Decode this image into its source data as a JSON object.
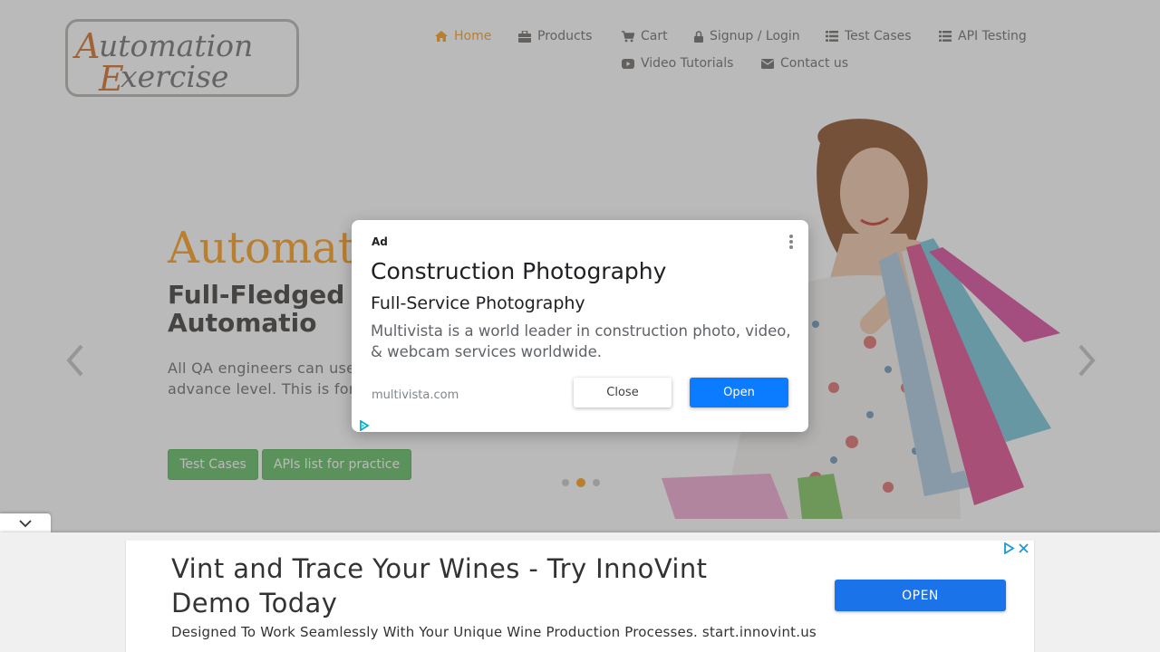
{
  "colors": {
    "accent": "#fe980f",
    "nav_text": "#696763",
    "button_green": "#5cb85c",
    "ad_open_blue": "#0b7cff",
    "bottom_ad_blue": "#1a73e8"
  },
  "logo": {
    "line1": "Automation",
    "line2": "Exercise"
  },
  "nav": [
    {
      "label": "Home",
      "icon": "home-icon"
    },
    {
      "label": "Products",
      "icon": "briefcase-icon"
    },
    {
      "label": "Cart",
      "icon": "cart-icon"
    },
    {
      "label": "Signup / Login",
      "icon": "lock-icon"
    },
    {
      "label": "Test Cases",
      "icon": "list-icon"
    },
    {
      "label": "API Testing",
      "icon": "list-icon"
    },
    {
      "label": "Video Tutorials",
      "icon": "youtube-play-icon"
    },
    {
      "label": "Contact us",
      "icon": "envelope-icon"
    }
  ],
  "slider": {
    "title": "Automat",
    "subtitle": "Full-Fledged for Automatio",
    "description": "All QA engineers can use practice and API testing e advance level. This is for their automation skills.",
    "buttons": [
      "Test Cases",
      "APIs list for practice"
    ],
    "active_slide": 2,
    "slide_count": 3
  },
  "modal_ad": {
    "ad_label": "Ad",
    "title": "Construction Photography",
    "subtitle": "Full-Service Photography",
    "body": "Multivista is a world leader in construction photo, video, & webcam services worldwide.",
    "domain": "multivista.com",
    "close_label": "Close",
    "open_label": "Open"
  },
  "bottom_ad": {
    "title": "Vint and Trace Your Wines - Try InnoVint Demo Today",
    "description": "Designed To Work Seamlessly With Your Unique Wine Production Processes. start.innovint.us",
    "button_label": "OPEN"
  }
}
